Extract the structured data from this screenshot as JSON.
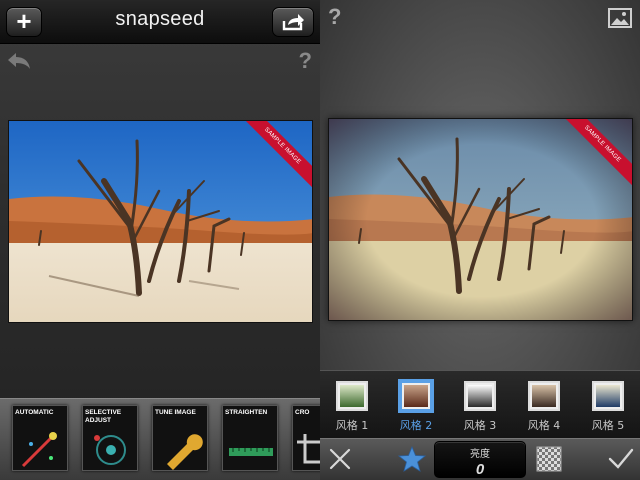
{
  "left_panel": {
    "app_title": "snapseed",
    "photo_ribbon": "SAMPLE IMAGE",
    "help_text": "?",
    "tools": [
      {
        "label": "AUTOMATIC",
        "icon": "magic-wand-icon"
      },
      {
        "label": "SELECTIVE ADJUST",
        "icon": "control-points-icon"
      },
      {
        "label": "TUNE IMAGE",
        "icon": "wrench-icon"
      },
      {
        "label": "STRAIGHTEN",
        "icon": "ruler-icon"
      },
      {
        "label": "CRO",
        "icon": "crop-icon"
      }
    ],
    "icons": {
      "add": "plus-icon",
      "share": "share-icon",
      "undo": "undo-arrow-icon"
    }
  },
  "right_panel": {
    "help_text": "?",
    "photo_ribbon": "SAMPLE IMAGE",
    "styles": [
      {
        "label": "风格 1",
        "colors": [
          "#dde8c8",
          "#3d6a2e"
        ],
        "selected": false
      },
      {
        "label": "风格 2",
        "colors": [
          "#c9a48a",
          "#5a2a1a"
        ],
        "selected": true
      },
      {
        "label": "风格 3",
        "colors": [
          "#ffffff",
          "#2a2a2a"
        ],
        "selected": false
      },
      {
        "label": "风格 4",
        "colors": [
          "#d8c2a8",
          "#3a2a22"
        ],
        "selected": false
      },
      {
        "label": "风格 5",
        "colors": [
          "#eae6d0",
          "#1f3b66"
        ],
        "selected": false
      }
    ],
    "brightness": {
      "label": "亮度",
      "value": "0"
    },
    "icons": {
      "cancel": "close-icon",
      "favorite": "star-icon",
      "texture": "checkerboard-icon",
      "apply": "checkmark-icon",
      "image": "image-icon"
    }
  },
  "colors": {
    "accent": "#5aa0e6",
    "ribbon": "#c8102e"
  }
}
